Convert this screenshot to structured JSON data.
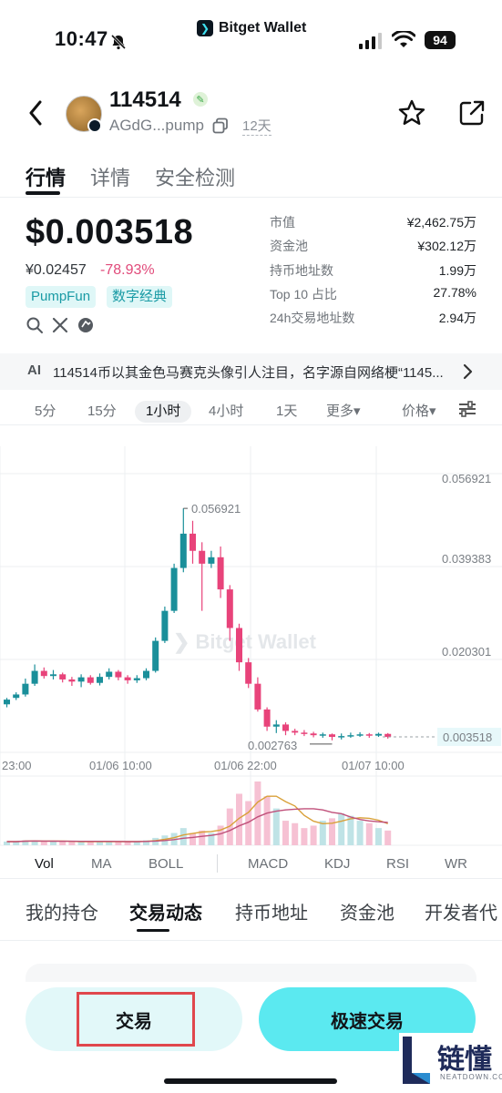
{
  "status_bar": {
    "time": "10:47",
    "brand": "Bitget Wallet",
    "battery": "94"
  },
  "header": {
    "name": "114514",
    "address": "AGdG...pump",
    "age": "12天"
  },
  "tabs": [
    {
      "label": "行情"
    },
    {
      "label": "详情"
    },
    {
      "label": "安全检测"
    }
  ],
  "price": {
    "usd": "$0.003518",
    "cny": "¥0.02457",
    "change": "-78.93%",
    "tags": [
      "PumpFun",
      "数字经典"
    ]
  },
  "stats": [
    {
      "label": "市值",
      "value": "¥2,462.75万"
    },
    {
      "label": "资金池",
      "value": "¥302.12万"
    },
    {
      "label": "持币地址数",
      "value": "1.99万"
    },
    {
      "label": "Top 10 占比",
      "value": "27.78%"
    },
    {
      "label": "24h交易地址数",
      "value": "2.94万"
    }
  ],
  "ai_banner": {
    "icon": "AI",
    "text": "114514币以其金色马赛克头像引人注目，名字源自网络梗“1145..."
  },
  "intervals": [
    {
      "label": "5分"
    },
    {
      "label": "15分"
    },
    {
      "label": "1小时"
    },
    {
      "label": "4小时"
    },
    {
      "label": "1天"
    },
    {
      "label": "更多▾"
    },
    {
      "label": "价格▾"
    }
  ],
  "chart_data": {
    "type": "candlestick",
    "watermark": "Bitget Wallet",
    "y_ticks": [
      "0.056921",
      "0.039383",
      "0.020301"
    ],
    "current_price_label": "0.003518",
    "high_label": "0.056921",
    "low_label": "0.002763",
    "x_ticks": [
      "23:00",
      "01/06 10:00",
      "01/06 22:00",
      "01/07 10:00"
    ],
    "ylim": [
      0,
      0.065
    ],
    "candles": [
      [
        0.0112,
        0.0123,
        0.0105,
        0.0127
      ],
      [
        0.0127,
        0.0135,
        0.0122,
        0.014
      ],
      [
        0.0135,
        0.016,
        0.013,
        0.0172
      ],
      [
        0.016,
        0.019,
        0.0155,
        0.0205
      ],
      [
        0.019,
        0.0178,
        0.0172,
        0.0198
      ],
      [
        0.0178,
        0.0182,
        0.017,
        0.0192
      ],
      [
        0.0182,
        0.017,
        0.0163,
        0.0186
      ],
      [
        0.017,
        0.0165,
        0.0155,
        0.0176
      ],
      [
        0.0165,
        0.0175,
        0.0152,
        0.0182
      ],
      [
        0.0175,
        0.0162,
        0.0158,
        0.018
      ],
      [
        0.0162,
        0.0176,
        0.0156,
        0.0184
      ],
      [
        0.0176,
        0.0188,
        0.017,
        0.0196
      ],
      [
        0.0188,
        0.0175,
        0.0168,
        0.0192
      ],
      [
        0.0175,
        0.0168,
        0.016,
        0.018
      ],
      [
        0.0168,
        0.0173,
        0.0162,
        0.018
      ],
      [
        0.0173,
        0.019,
        0.0168,
        0.0196
      ],
      [
        0.019,
        0.026,
        0.0186,
        0.0268
      ],
      [
        0.026,
        0.033,
        0.0255,
        0.034
      ],
      [
        0.033,
        0.043,
        0.0325,
        0.044
      ],
      [
        0.043,
        0.051,
        0.042,
        0.0569
      ],
      [
        0.051,
        0.047,
        0.044,
        0.054
      ],
      [
        0.047,
        0.044,
        0.033,
        0.049
      ],
      [
        0.044,
        0.0455,
        0.043,
        0.047
      ],
      [
        0.0455,
        0.038,
        0.036,
        0.048
      ],
      [
        0.038,
        0.029,
        0.026,
        0.039
      ],
      [
        0.029,
        0.021,
        0.019,
        0.03
      ],
      [
        0.021,
        0.016,
        0.015,
        0.022
      ],
      [
        0.016,
        0.01,
        0.0095,
        0.0175
      ],
      [
        0.01,
        0.006,
        0.005,
        0.0105
      ],
      [
        0.006,
        0.0065,
        0.0045,
        0.0075
      ],
      [
        0.0065,
        0.005,
        0.004,
        0.007
      ],
      [
        0.005,
        0.0046,
        0.004,
        0.0055
      ],
      [
        0.0046,
        0.0044,
        0.0038,
        0.0052
      ],
      [
        0.0044,
        0.004,
        0.0035,
        0.0048
      ],
      [
        0.004,
        0.0042,
        0.0034,
        0.0046
      ],
      [
        0.0042,
        0.0036,
        0.0028,
        0.0044
      ],
      [
        0.0036,
        0.0038,
        0.003,
        0.0044
      ],
      [
        0.0038,
        0.004,
        0.0034,
        0.0046
      ],
      [
        0.004,
        0.0042,
        0.0036,
        0.0047
      ],
      [
        0.0042,
        0.0039,
        0.0034,
        0.0045
      ],
      [
        0.0039,
        0.0043,
        0.0036,
        0.0046
      ],
      [
        0.0043,
        0.0036,
        0.0032,
        0.0045
      ]
    ],
    "volume": [
      0.03,
      0.03,
      0.04,
      0.04,
      0.03,
      0.03,
      0.03,
      0.03,
      0.03,
      0.03,
      0.03,
      0.03,
      0.03,
      0.03,
      0.03,
      0.04,
      0.06,
      0.08,
      0.1,
      0.14,
      0.1,
      0.12,
      0.1,
      0.16,
      0.3,
      0.42,
      0.36,
      0.52,
      0.4,
      0.3,
      0.2,
      0.18,
      0.14,
      0.16,
      0.2,
      0.22,
      0.26,
      0.24,
      0.2,
      0.18,
      0.14,
      0.12
    ]
  },
  "indicators": [
    {
      "label": "Vol"
    },
    {
      "label": "MA"
    },
    {
      "label": "BOLL"
    },
    {
      "label": "MACD"
    },
    {
      "label": "KDJ"
    },
    {
      "label": "RSI"
    },
    {
      "label": "WR"
    }
  ],
  "sections": [
    {
      "label": "我的持仓"
    },
    {
      "label": "交易动态"
    },
    {
      "label": "持币地址"
    },
    {
      "label": "资金池"
    },
    {
      "label": "开发者代"
    }
  ],
  "buttons": {
    "trade": "交易",
    "fast_trade": "极速交易"
  },
  "watermark": {
    "text": "链懂",
    "sub": "NEATDOWN.COM"
  },
  "colors": {
    "up": "#1a8f9a",
    "down": "#e8437a",
    "accent": "#5be9f0"
  }
}
